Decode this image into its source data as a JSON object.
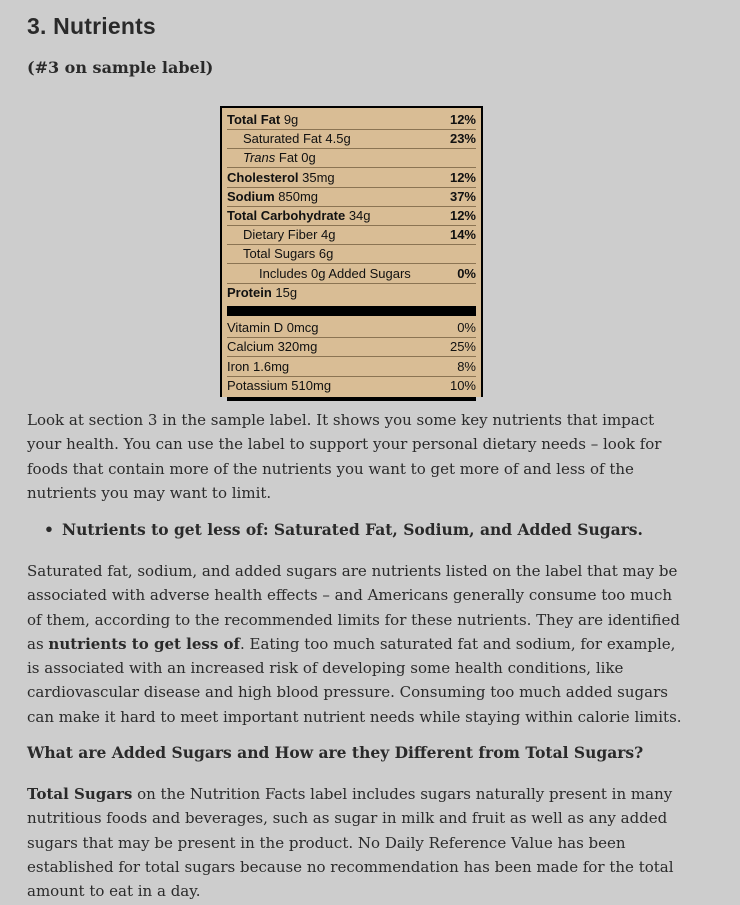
{
  "heading": "3. Nutrients",
  "subheading": "(#3 on sample label)",
  "label": {
    "rows": [
      {
        "bold": "Total Fat",
        "rest": " 9g",
        "pct": "12%",
        "indent": 0
      },
      {
        "bold": "",
        "rest": "Saturated Fat 4.5g",
        "pct": "23%",
        "indent": 1
      },
      {
        "italic": "Trans",
        "rest": " Fat 0g",
        "pct": "",
        "indent": 1
      },
      {
        "bold": "Cholesterol",
        "rest": " 35mg",
        "pct": "12%",
        "indent": 0
      },
      {
        "bold": "Sodium",
        "rest": " 850mg",
        "pct": "37%",
        "indent": 0
      },
      {
        "bold": "Total Carbohydrate",
        "rest": " 34g",
        "pct": "12%",
        "indent": 0
      },
      {
        "bold": "",
        "rest": "Dietary Fiber 4g",
        "pct": "14%",
        "indent": 1
      },
      {
        "bold": "",
        "rest": "Total Sugars 6g",
        "pct": "",
        "indent": 1
      },
      {
        "bold": "",
        "rest": "Includes 0g Added Sugars",
        "pct": "0%",
        "indent": 2
      },
      {
        "bold": "Protein",
        "rest": " 15g",
        "pct": "",
        "indent": 0
      }
    ],
    "vitamins": [
      {
        "name": "Vitamin D 0mcg",
        "pct": "0%"
      },
      {
        "name": "Calcium 320mg",
        "pct": "25%"
      },
      {
        "name": "Iron 1.6mg",
        "pct": "8%"
      },
      {
        "name": "Potassium 510mg",
        "pct": "10%"
      }
    ]
  },
  "para1": "Look at section 3 in the sample label. It shows you some key nutrients that impact your health. You can use the label to support your personal dietary needs – look for foods that contain more of the nutrients you want to get more of and less of the nutrients you may want to limit.",
  "bullet": "Nutrients to get less of: Saturated Fat, Sodium, and Added Sugars.",
  "para2_a": "Saturated fat, sodium, and added sugars are nutrients listed on the label that may be associated with adverse health effects – and Americans generally consume too much of them, according to the recommended limits for these nutrients. They are identified as ",
  "para2_bold": "nutrients to get less of",
  "para2_b": ". Eating too much saturated fat and sodium, for example, is associated with an increased risk of developing some health conditions, like cardiovascular disease and high blood pressure. Consuming too much added sugars can make it hard to meet important nutrient needs while staying within calorie limits.",
  "question": "What are Added Sugars and How are they Different from Total Sugars?",
  "para3_bold": "Total Sugars",
  "para3_rest": " on the Nutrition Facts label includes sugars naturally present in many nutritious foods and beverages, such as sugar in milk and fruit as well as any added sugars that may be present in the product. No Daily Reference Value has been established for total sugars because no recommendation has been made for the total amount to eat in a day."
}
